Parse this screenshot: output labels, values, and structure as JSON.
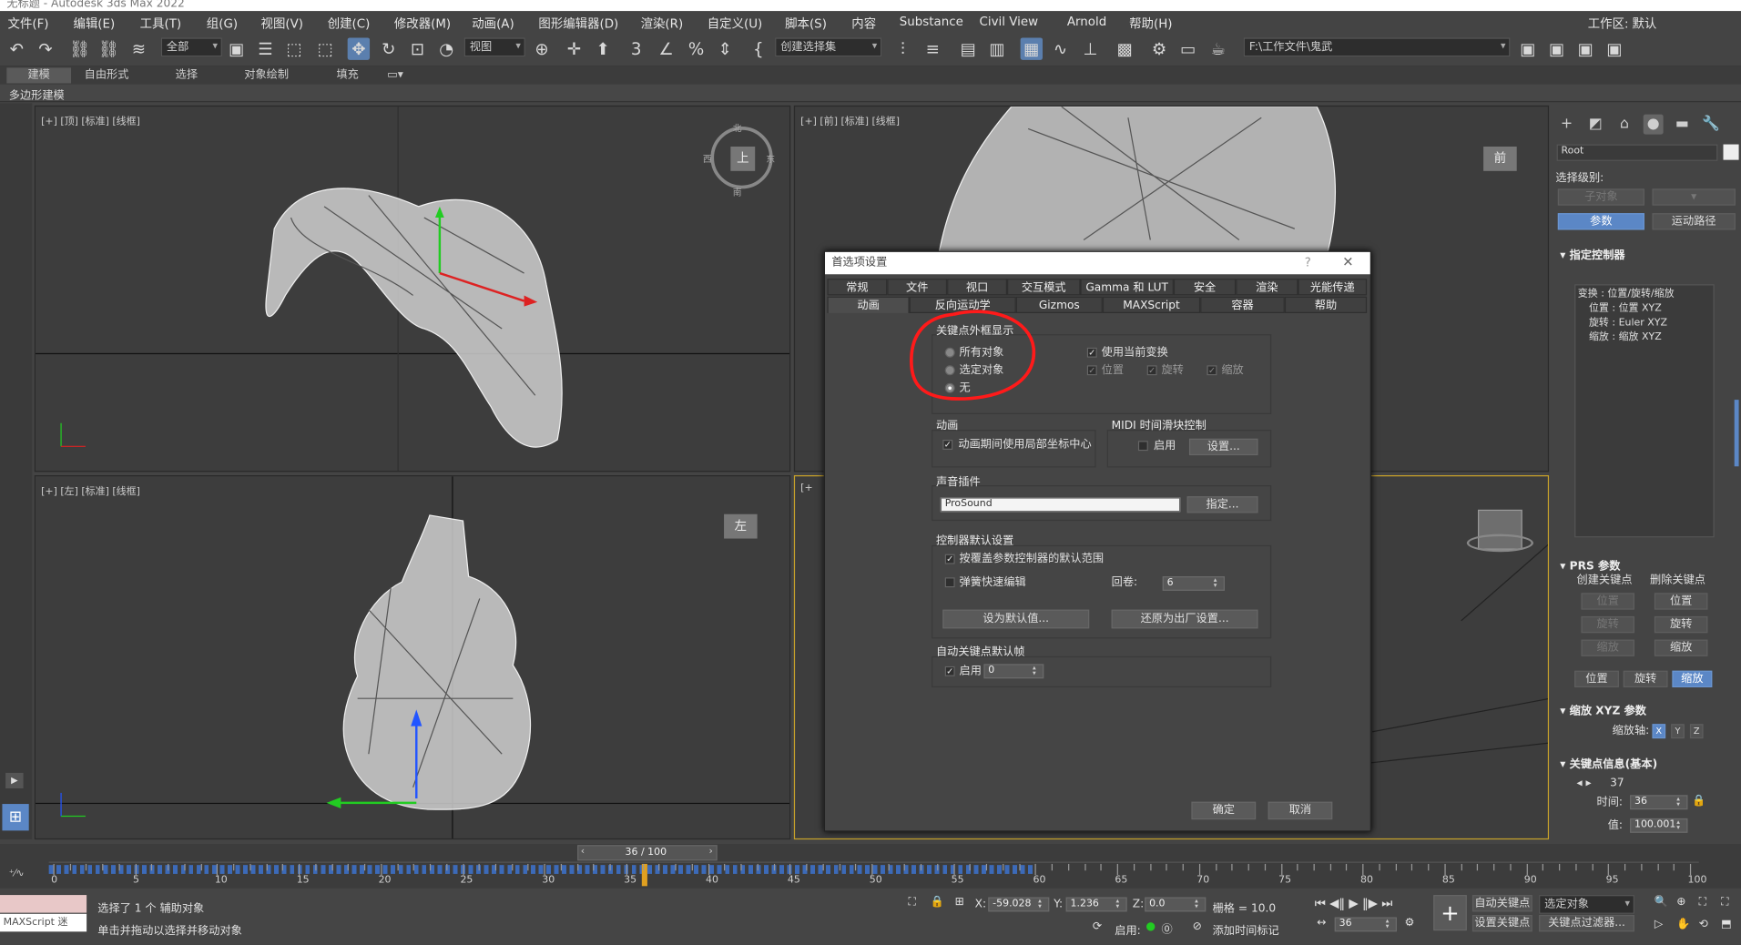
{
  "window": {
    "title": "无标题 - Autodesk 3ds Max 2022"
  },
  "menubar": {
    "items": [
      "文件(F)",
      "编辑(E)",
      "工具(T)",
      "组(G)",
      "视图(V)",
      "创建(C)",
      "修改器(M)",
      "动画(A)",
      "图形编辑器(D)",
      "渲染(R)",
      "自定义(U)",
      "脚本(S)",
      "内容",
      "Substance",
      "Civil View",
      "Arnold",
      "帮助(H)"
    ],
    "workspace_label": "工作区:",
    "workspace_value": "默认"
  },
  "toolbar": {
    "selection_filter": "全部",
    "ref_coord": "视图",
    "named_selection": "创建选择集",
    "project_path": "F:\\工作文件\\鬼武"
  },
  "ribbon": {
    "tabs": [
      "建模",
      "自由形式",
      "选择",
      "对象绘制",
      "填充"
    ],
    "sub_label": "多边形建模"
  },
  "viewports": {
    "top": "[+] [顶] [标准] [线框]",
    "front": "[+] [前] [标准] [线框]",
    "left": "[+] [左] [标准] [线框]",
    "persp": "[+",
    "viewcube_top": "上",
    "viewcube_front": "前",
    "viewcube_left": "左",
    "compass_n": "北",
    "compass_s": "南",
    "compass_e": "东",
    "compass_w": "西"
  },
  "dialog": {
    "title": "首选项设置",
    "help": "?",
    "close": "✕",
    "tabs_row1": [
      "常规",
      "文件",
      "视口",
      "交互模式",
      "Gamma 和 LUT",
      "安全",
      "渲染",
      "光能传递"
    ],
    "tabs_row2": [
      "动画",
      "反向运动学",
      "Gizmos",
      "MAXScript",
      "容器",
      "帮助"
    ],
    "key_bracket": {
      "title": "关键点外框显示",
      "options": [
        "所有对象",
        "选定对象",
        "无"
      ],
      "use_current_transform": "使用当前变换",
      "position": "位置",
      "rotation": "旋转",
      "scale": "缩放"
    },
    "animation": {
      "title": "动画",
      "local_center": "动画期间使用局部坐标中心"
    },
    "midi": {
      "title": "MIDI 时间滑块控制",
      "enable": "启用",
      "setup": "设置..."
    },
    "sound": {
      "title": "声音插件",
      "value": "ProSound",
      "assign": "指定..."
    },
    "controller": {
      "title": "控制器默认设置",
      "override": "按覆盖参数控制器的默认范围",
      "spring": "弹簧快速编辑",
      "rolls_label": "回卷:",
      "rolls_value": "6",
      "set_defaults": "设为默认值...",
      "restore": "还原为出厂设置..."
    },
    "autokey": {
      "title": "自动关键点默认帧",
      "enable": "启用",
      "value": "0"
    },
    "ok": "确定",
    "cancel": "取消"
  },
  "cmdpanel": {
    "root": "Root",
    "sel_level": "选择级别:",
    "subobj": "子对象",
    "params": "参数",
    "trajectories": "运动路径",
    "assign_controller": "指定控制器",
    "tree": [
      "变换 : 位置/旋转/缩放",
      "位置 : 位置 XYZ",
      "旋转 : Euler XYZ",
      "缩放 : 缩放 XYZ"
    ],
    "prs": "PRS 参数",
    "create_key": "创建关键点",
    "delete_key": "删除关键点",
    "pos": "位置",
    "rot": "旋转",
    "scl": "缩放",
    "scale_xyz": "缩放 XYZ 参数",
    "scale_axis": "缩放轴:",
    "axes": [
      "X",
      "Y",
      "Z"
    ],
    "key_info": "关键点信息(基本)",
    "key_num": "37",
    "time_label": "时间:",
    "time_value": "36",
    "value_label": "值:",
    "value_value": "100.001"
  },
  "timeline": {
    "frame_display": "36 / 100",
    "ticks": [
      "0",
      "5",
      "10",
      "15",
      "20",
      "25",
      "30",
      "35",
      "40",
      "45",
      "50",
      "55",
      "60",
      "65",
      "70",
      "75",
      "80",
      "85",
      "90",
      "95",
      "100"
    ]
  },
  "status": {
    "maxscript": "MAXScript 迷",
    "selected": "选择了 1 个 辅助对象",
    "prompt": "单击并拖动以选择并移动对象",
    "x_label": "X:",
    "x_value": "-59.028",
    "y_label": "Y:",
    "y_value": "1.236",
    "z_label": "Z:",
    "z_value": "0.0",
    "grid": "栅格 = 10.0",
    "enable": "启用:",
    "add_time_tag": "添加时间标记",
    "auto_key": "自动关键点",
    "set_key": "设置关键点",
    "selected_obj": "选定对象",
    "key_filters": "关键点过滤器...",
    "frame": "36"
  },
  "colors": {
    "accent": "#5b87c6",
    "annotation": "#ff1a1a",
    "active_border": "#c8a22a"
  }
}
